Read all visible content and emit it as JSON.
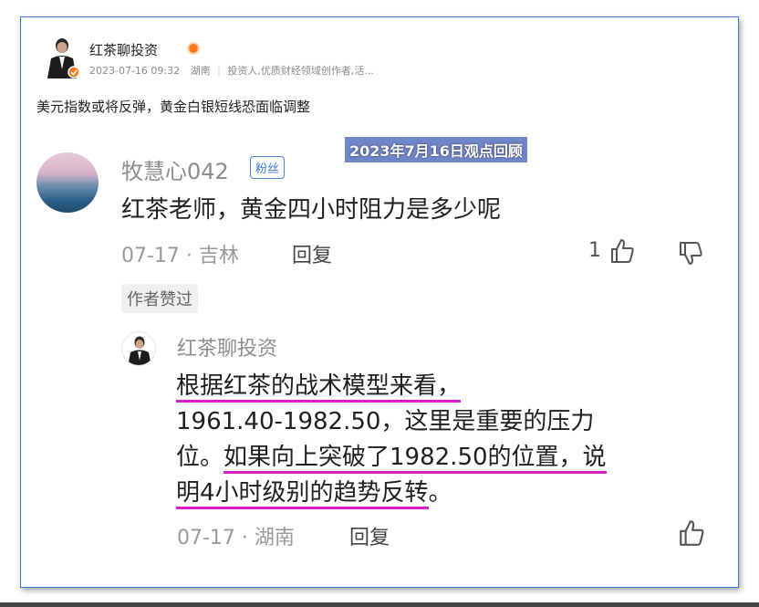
{
  "post": {
    "author": "红茶聊投资",
    "date": "2023-07-16 09:32",
    "location": "湖南",
    "bio": "投资人,优质财经领域创作者,活...",
    "title": "美元指数或将反弹，黄金白银短线恐面临调整"
  },
  "stamp": "2023年7月16日观点回顾",
  "comment": {
    "user": "牧慧心042",
    "badge": "粉丝",
    "text": "红茶老师，黄金四小时阻力是多少呢",
    "date_location": "07-17 · 吉林",
    "reply_label": "回复",
    "likes": "1",
    "author_liked": "作者赞过"
  },
  "reply": {
    "user": "红茶聊投资",
    "line1": "根据红茶的战术模型来看，",
    "line2": "1961.40-1982.50，这里是重要的压力",
    "line3_a": "位。",
    "line3_b": "如果向上突破了1982.50的位置，说",
    "line4_a": "明4小时级别的趋势反转",
    "line4_b": "。",
    "date_location": "07-17 · 湖南",
    "reply_label": "回复"
  },
  "colors": {
    "underline": "#d81ccf",
    "frame_border": "#3d7bd2",
    "fan_badge": "#3b76cf",
    "post_badge": "#ff7a1a"
  }
}
